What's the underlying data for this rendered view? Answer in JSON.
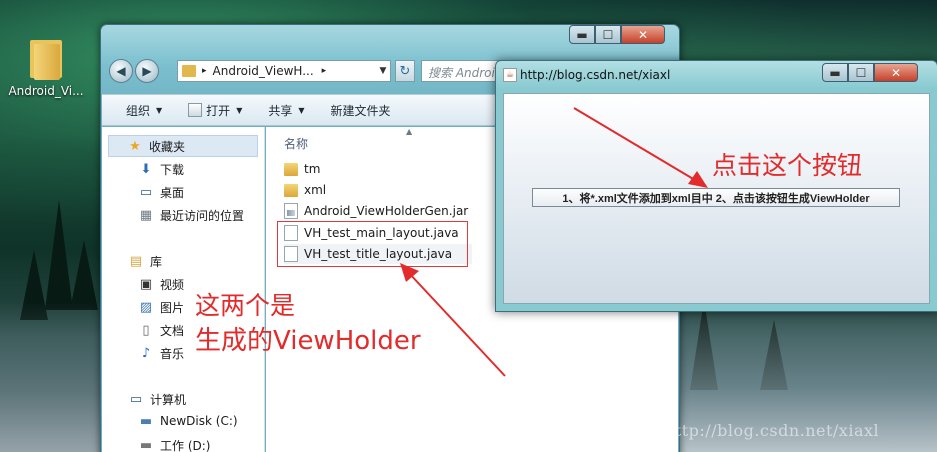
{
  "desktop": {
    "icon_label": "Android_Vi..."
  },
  "explorer": {
    "address_segment": "Android_ViewH...",
    "search_placeholder": "搜索 Android...",
    "toolbar": {
      "organize": "组织",
      "open": "打开",
      "share": "共享",
      "new_folder": "新建文件夹"
    },
    "nav": {
      "favorites": "收藏夹",
      "downloads": "下载",
      "desktop": "桌面",
      "recent": "最近访问的位置",
      "libraries": "库",
      "videos": "视频",
      "pictures": "图片",
      "documents": "文档",
      "music": "音乐",
      "computer": "计算机",
      "newdisk": "NewDisk (C:)",
      "work": "工作 (D:)"
    },
    "column_header": "名称",
    "files": [
      {
        "name": "tm",
        "type": "folder"
      },
      {
        "name": "xml",
        "type": "folder"
      },
      {
        "name": "Android_ViewHolderGen.jar",
        "type": "jar"
      },
      {
        "name": "VH_test_main_layout.java",
        "type": "java"
      },
      {
        "name": "VH_test_title_layout.java",
        "type": "java"
      }
    ]
  },
  "java_window": {
    "title": "http://blog.csdn.net/xiaxl",
    "button_label": "1、将*.xml文件添加到xml目中  2、点击该按钮生成ViewHolder"
  },
  "annotations": {
    "click_button": "点击这个按钮",
    "line1": "这两个是",
    "line2": "生成的ViewHolder"
  },
  "watermark": "http://blog.csdn.net/xiaxl",
  "colors": {
    "annotation_red": "#e22b2b",
    "selection_blue": "#dce9f5"
  }
}
